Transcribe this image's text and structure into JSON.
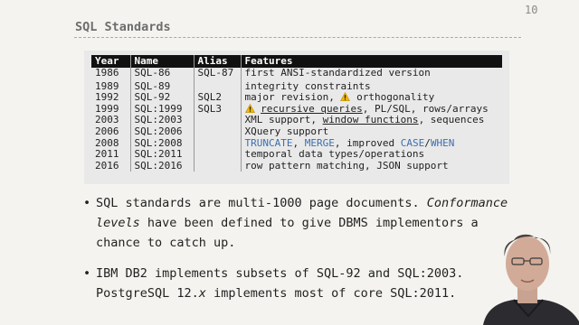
{
  "slide": {
    "title": "SQL Standards",
    "page_number": "10"
  },
  "table": {
    "headers": [
      "Year",
      "Name",
      "Alias",
      "Features"
    ],
    "rows": [
      {
        "year": "1986",
        "name": "SQL-86",
        "alias": "SQL-87",
        "features": [
          "first ANSI-standardized version"
        ]
      },
      {
        "year": "1989",
        "name": "SQL-89",
        "alias": "",
        "features": [
          "integrity constraints"
        ]
      },
      {
        "year": "1992",
        "name": "SQL-92",
        "alias": "SQL2",
        "features": [
          "major revision, ",
          "orthogonality"
        ]
      },
      {
        "year": "1999",
        "name": "SQL:1999",
        "alias": "SQL3",
        "features": [
          "recursive queries",
          ", PL/SQL, rows/arrays"
        ]
      },
      {
        "year": "2003",
        "name": "SQL:2003",
        "alias": "",
        "features": [
          "XML support, ",
          "window functions",
          ", sequences"
        ]
      },
      {
        "year": "2006",
        "name": "SQL:2006",
        "alias": "",
        "features": [
          "XQuery support"
        ]
      },
      {
        "year": "2008",
        "name": "SQL:2008",
        "alias": "",
        "features": [
          "TRUNCATE",
          ", ",
          "MERGE",
          ", improved ",
          "CASE",
          "/",
          "WHEN"
        ]
      },
      {
        "year": "2011",
        "name": "SQL:2011",
        "alias": "",
        "features": [
          "temporal data types/operations"
        ]
      },
      {
        "year": "2016",
        "name": "SQL:2016",
        "alias": "",
        "features": [
          "row pattern matching, JSON support"
        ]
      }
    ]
  },
  "bullets": [
    {
      "parts": [
        "SQL standards are multi-1000 page documents. ",
        "Conformance levels",
        " have been defined to give DBMS implementors a chance to catch up."
      ]
    },
    {
      "parts": [
        "IBM DB2 implements subsets of SQL-92 and SQL:2003. PostgreSQL 12.",
        "x",
        " implements most of core SQL:2011."
      ]
    }
  ],
  "icons": {
    "warning": "warning-icon",
    "warning_color": "#f2b705",
    "keyword_color": "#3b6fb0"
  }
}
